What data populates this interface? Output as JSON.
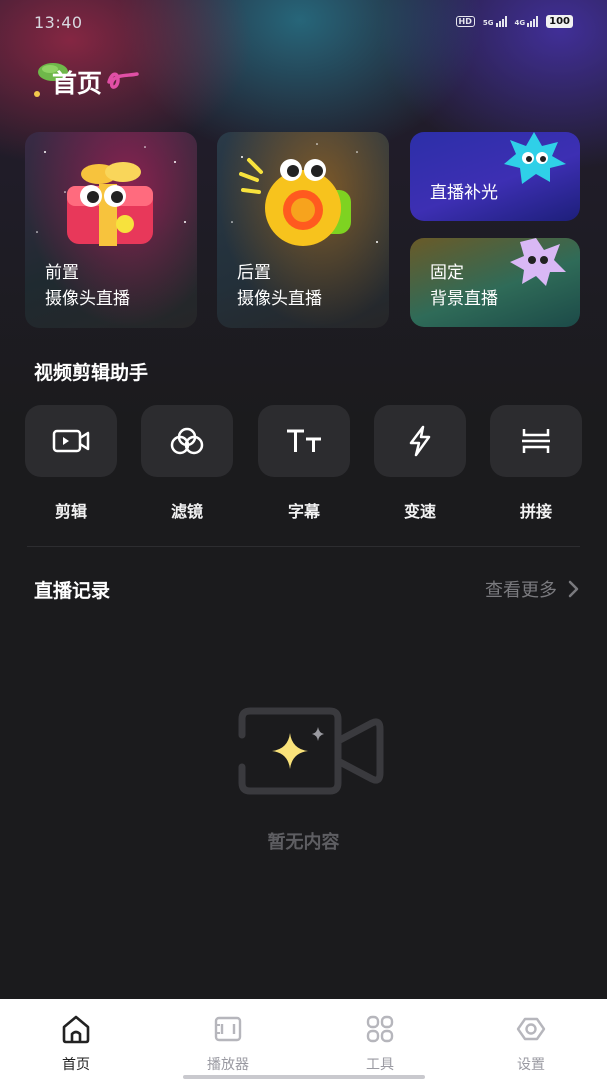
{
  "status_bar": {
    "time": "13:40",
    "hd_label": "HD",
    "network_5g": "5G",
    "network_4g": "4G",
    "battery": "100"
  },
  "header": {
    "title": "首页"
  },
  "feature_cards": [
    {
      "line1": "前置",
      "line2": "摄像头直播"
    },
    {
      "line1": "后置",
      "line2": "摄像头直播"
    },
    {
      "line1": "直播补光"
    },
    {
      "line1": "固定",
      "line2": "背景直播"
    }
  ],
  "video_tools": {
    "title": "视频剪辑助手",
    "items": [
      {
        "label": "剪辑",
        "icon": "video-clip-icon"
      },
      {
        "label": "滤镜",
        "icon": "filter-icon"
      },
      {
        "label": "字幕",
        "icon": "subtitle-icon"
      },
      {
        "label": "变速",
        "icon": "speed-icon"
      },
      {
        "label": "拼接",
        "icon": "splice-icon"
      }
    ]
  },
  "live_records": {
    "title": "直播记录",
    "see_more": "查看更多",
    "empty_text": "暂无内容"
  },
  "bottom_nav": {
    "items": [
      {
        "label": "首页",
        "icon": "home-icon",
        "active": true
      },
      {
        "label": "播放器",
        "icon": "player-icon",
        "active": false
      },
      {
        "label": "工具",
        "icon": "tools-icon",
        "active": false
      },
      {
        "label": "设置",
        "icon": "settings-eye-icon",
        "active": false
      }
    ]
  },
  "colors": {
    "background": "#1b1b1d",
    "tile": "#2c2c2f",
    "nav_background": "#ffffff",
    "muted_text": "#7a7a7e"
  }
}
